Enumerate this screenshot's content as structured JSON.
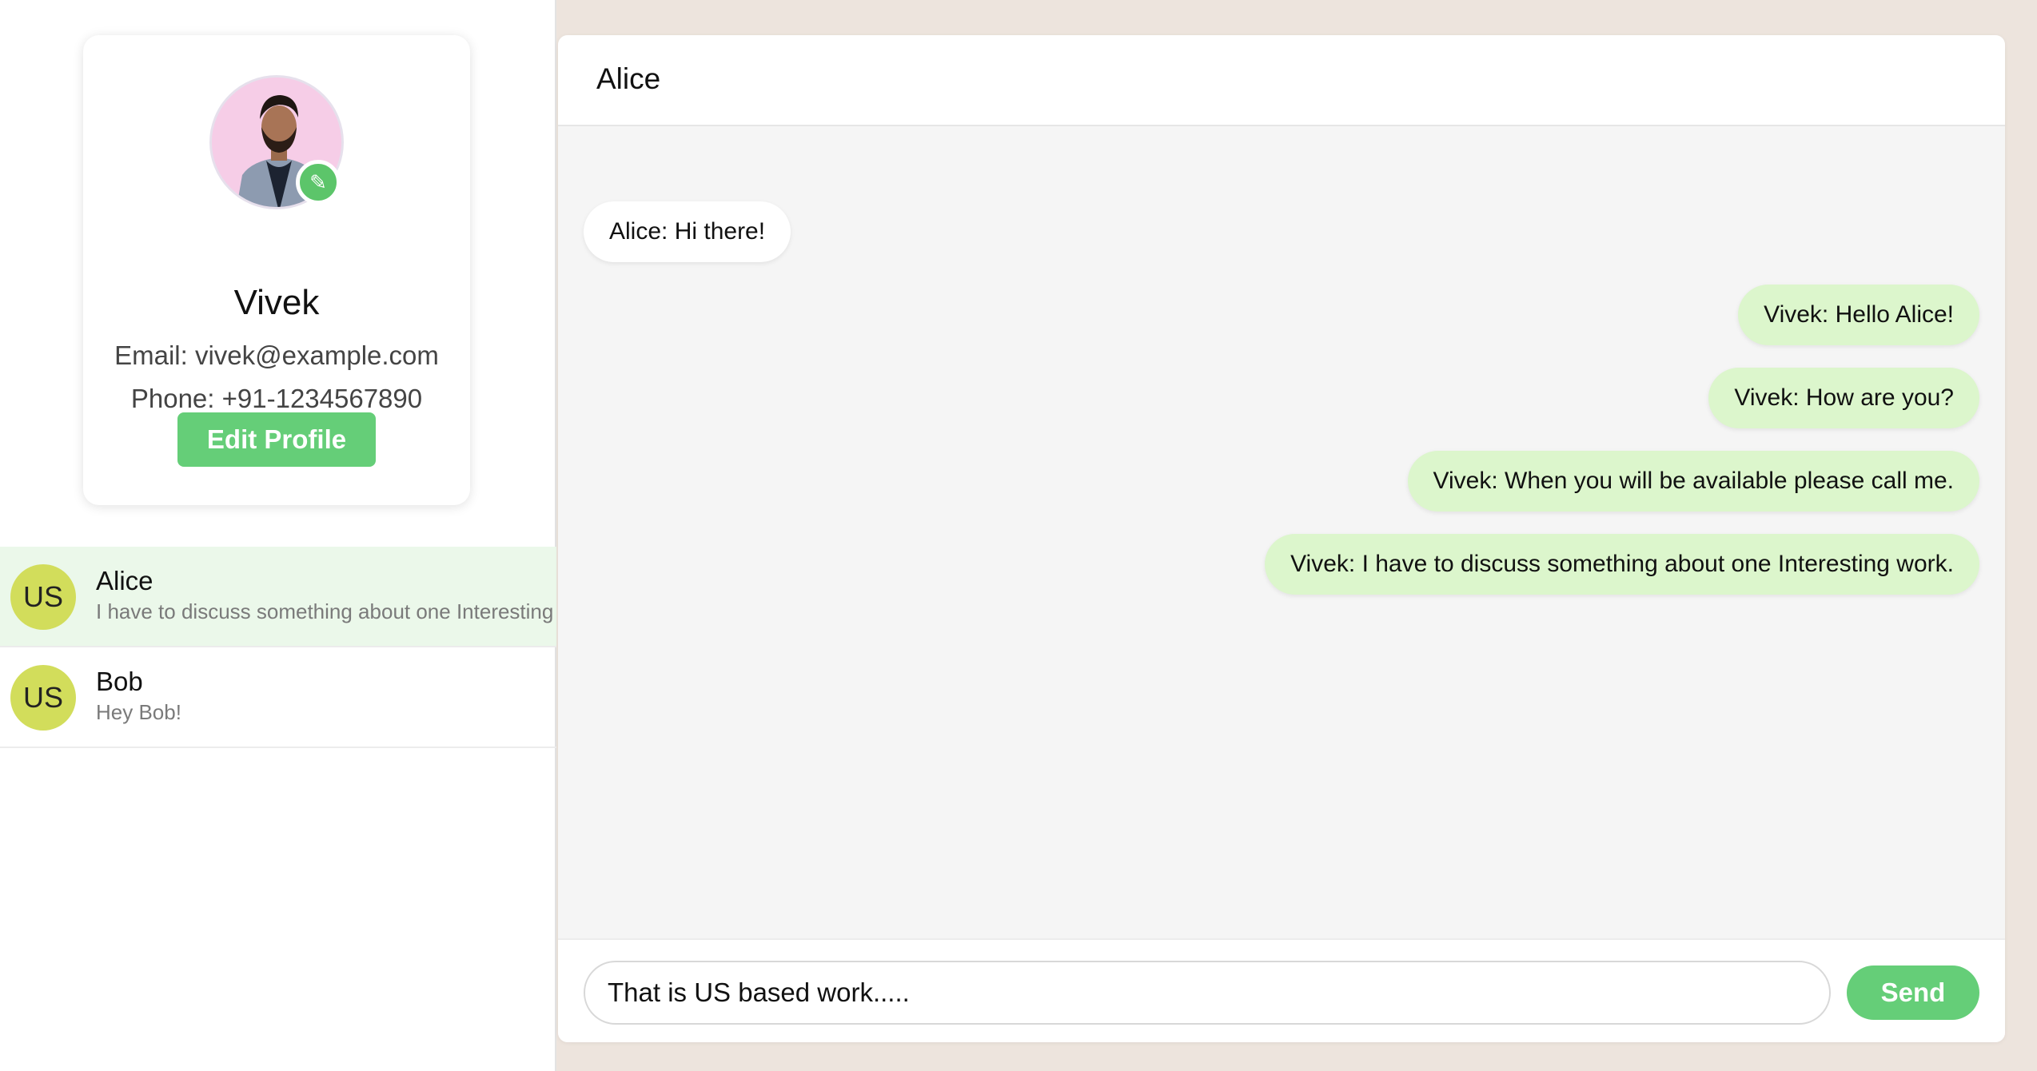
{
  "profile": {
    "name": "Vivek",
    "email": "Email: vivek@example.com",
    "phone": "Phone: +91-1234567890",
    "edit_button": "Edit Profile",
    "edit_badge_icon": "✎"
  },
  "contacts": [
    {
      "initials": "US",
      "name": "Alice",
      "preview": "I have to discuss something about one Interesting work.",
      "active": true
    },
    {
      "initials": "US",
      "name": "Bob",
      "preview": "Hey Bob!",
      "active": false
    }
  ],
  "chat": {
    "title": "Alice",
    "messages": [
      {
        "text": "Alice: Hi there!",
        "direction": "incoming"
      },
      {
        "text": "Vivek: Hello Alice!",
        "direction": "outgoing"
      },
      {
        "text": "Vivek: How are you?",
        "direction": "outgoing"
      },
      {
        "text": "Vivek: When you will be available please call me.",
        "direction": "outgoing"
      },
      {
        "text": "Vivek: I have to discuss something about one Interesting work.",
        "direction": "outgoing"
      }
    ],
    "input_value": "That is US based work.....",
    "send_label": "Send"
  },
  "colors": {
    "accent": "#65ce78",
    "outgoing_bubble": "#dcf6cc",
    "active_contact": "#ebf8ea",
    "contact_avatar": "#d2dd5b"
  }
}
